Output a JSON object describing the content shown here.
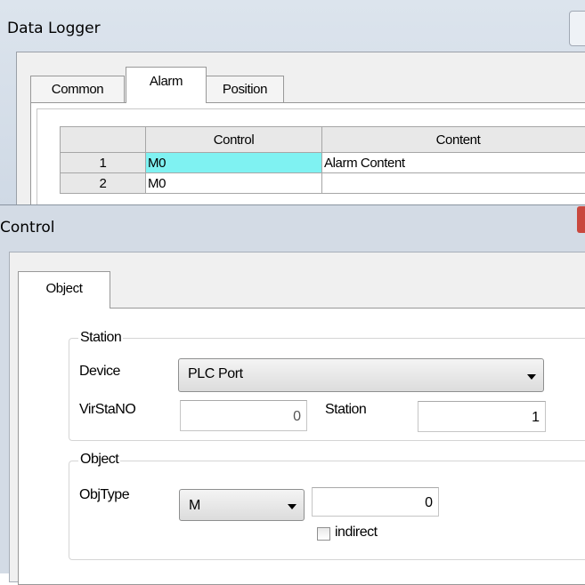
{
  "data_logger": {
    "title": "Data Logger",
    "tabs": [
      {
        "label": "Common",
        "active": false
      },
      {
        "label": "Alarm",
        "active": true
      },
      {
        "label": "Position",
        "active": false
      }
    ],
    "grid": {
      "columns": [
        "",
        "Control",
        "Content"
      ],
      "rows": [
        {
          "index": "1",
          "control": "M0",
          "content": "Alarm Content",
          "selected": true
        },
        {
          "index": "2",
          "control": "M0",
          "content": "",
          "selected": false
        }
      ]
    }
  },
  "control_dialog": {
    "title": "Control",
    "tabs": [
      {
        "label": "Object",
        "active": true
      }
    ],
    "station_group": {
      "legend": "Station",
      "device_label": "Device",
      "device_value": "PLC Port",
      "virstano_label": "VirStaNO",
      "virstano_value": "0",
      "station_label": "Station",
      "station_value": "1"
    },
    "object_group": {
      "legend": "Object",
      "objtype_label": "ObjType",
      "objtype_value": "M",
      "address_value": "0",
      "indirect_label": "indirect",
      "indirect_checked": false
    }
  },
  "colors": {
    "selected_cell": "#7ff2f2",
    "window_frame": "#d3dbe5",
    "close_button": "#c9483e"
  }
}
